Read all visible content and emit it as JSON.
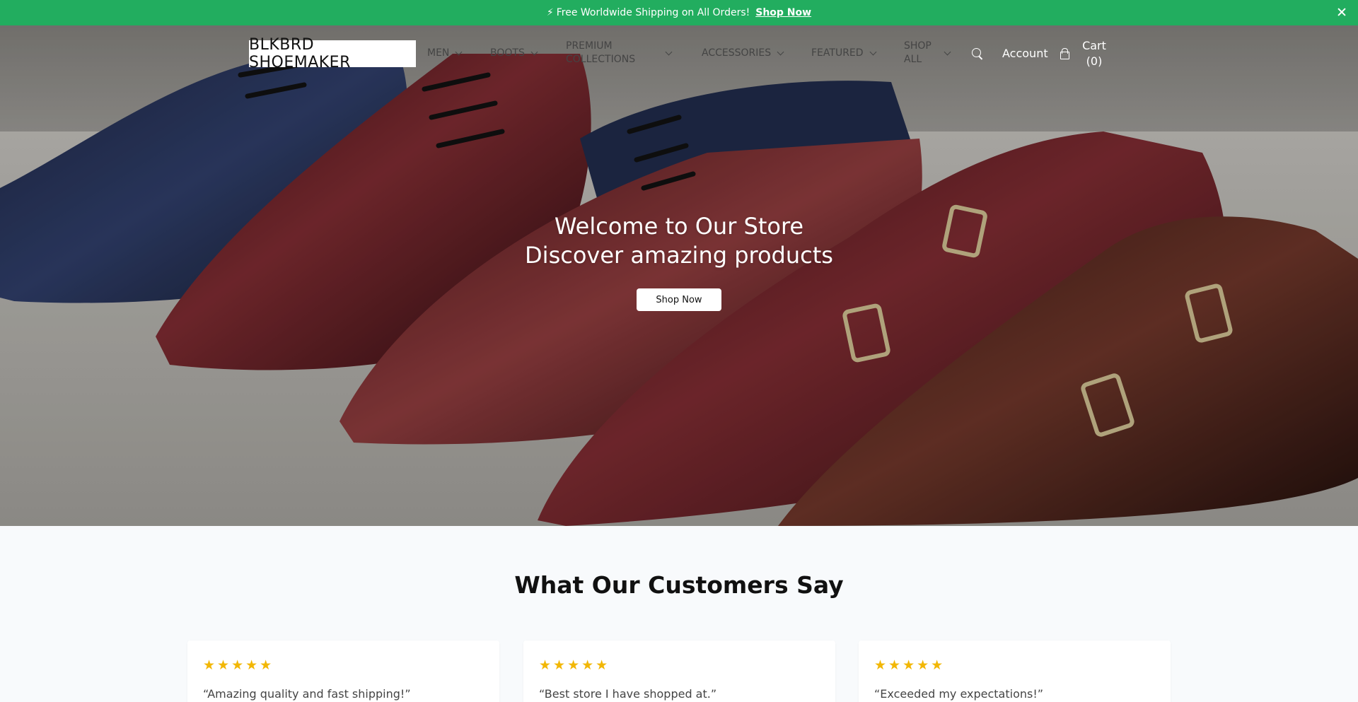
{
  "announcement": {
    "icon": "bolt-icon",
    "text": "Free Worldwide Shipping on All Orders!",
    "link_label": "Shop Now"
  },
  "header": {
    "logo": "BLKBRD SHOEMAKER",
    "nav": [
      {
        "label": "MEN"
      },
      {
        "label": "BOOTS"
      },
      {
        "label": "PREMIUM COLLECTIONS"
      },
      {
        "label": "ACCESSORIES"
      },
      {
        "label": "FEATURED"
      },
      {
        "label": "SHOP ALL"
      }
    ],
    "account_label": "Account",
    "cart_label": "Cart (0)"
  },
  "hero": {
    "title_line1": "Welcome to Our Store",
    "title_line2": "Discover amazing products",
    "cta_label": "Shop Now"
  },
  "testimonials": {
    "title": "What Our Customers Say",
    "items": [
      {
        "rating": 5,
        "stars": "★★★★★",
        "quote": "“Amazing quality and fast shipping!”"
      },
      {
        "rating": 5,
        "stars": "★★★★★",
        "quote": "“Best store I have shopped at.”"
      },
      {
        "rating": 5,
        "stars": "★★★★★",
        "quote": "“Exceeded my expectations!”"
      }
    ]
  },
  "colors": {
    "announcement_bg": "#22ad5f",
    "star": "#f2b705",
    "page_bg": "#f8fafc"
  }
}
